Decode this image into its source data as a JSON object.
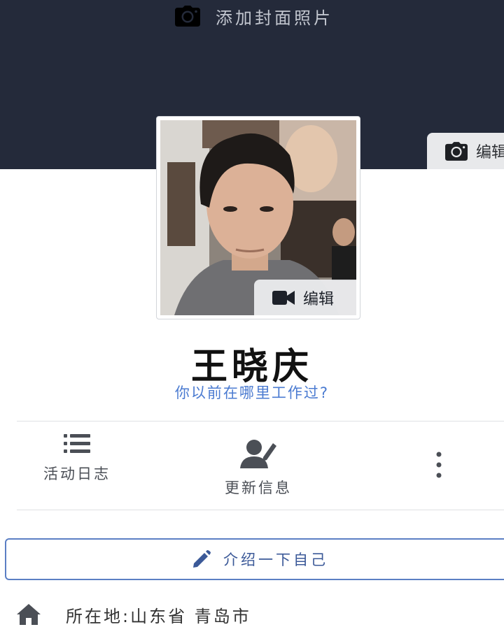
{
  "cover": {
    "add_cover_label": "添加封面照片",
    "edit_label": "编辑",
    "background_color": "#242a3a"
  },
  "profile": {
    "avatar_edit_label": "编辑",
    "name": "王晓庆",
    "work_prompt": "你以前在哪里工作过?"
  },
  "actions": {
    "activity_log": {
      "label": "活动日志",
      "icon": "list-icon"
    },
    "update_info": {
      "label": "更新信息",
      "icon": "user-edit-icon"
    },
    "more": {
      "icon": "more-vertical-icon"
    }
  },
  "intro": {
    "label": "介绍一下自己",
    "icon": "pencil-icon"
  },
  "about": {
    "location_label": "所在地:",
    "location_value": "山东省 青岛市",
    "icon": "home-icon"
  },
  "colors": {
    "link_blue": "#4b7bd1",
    "button_border": "#5b7fc4",
    "button_text": "#3b5998"
  }
}
